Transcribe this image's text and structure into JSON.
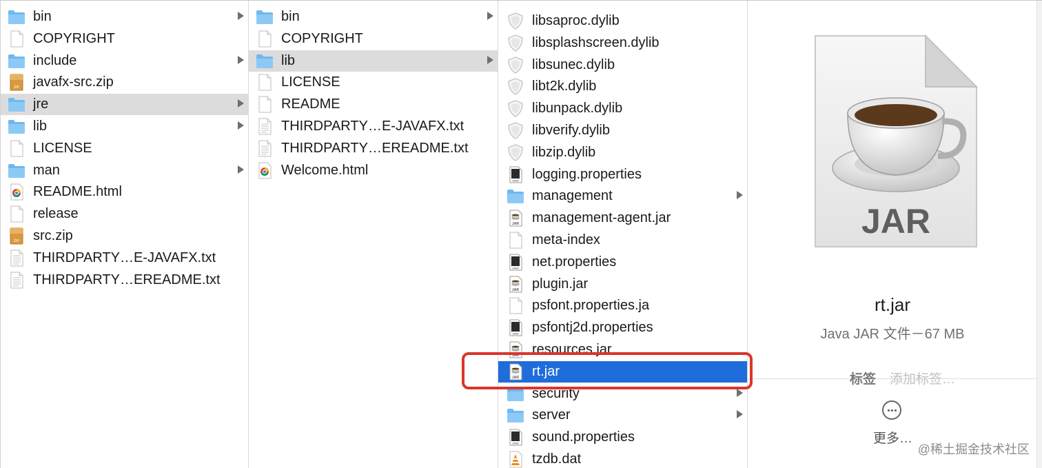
{
  "column1": {
    "items": [
      {
        "label": "bin",
        "icon": "folder-icon",
        "folder": true
      },
      {
        "label": "COPYRIGHT",
        "icon": "document-icon"
      },
      {
        "label": "include",
        "icon": "folder-icon",
        "folder": true
      },
      {
        "label": "javafx-src.zip",
        "icon": "zip-archive-icon"
      },
      {
        "label": "jre",
        "icon": "folder-icon",
        "folder": true,
        "selected": "gray"
      },
      {
        "label": "lib",
        "icon": "folder-icon",
        "folder": true
      },
      {
        "label": "LICENSE",
        "icon": "document-icon"
      },
      {
        "label": "man",
        "icon": "folder-icon",
        "folder": true
      },
      {
        "label": "README.html",
        "icon": "chrome-html-icon"
      },
      {
        "label": "release",
        "icon": "document-icon"
      },
      {
        "label": "src.zip",
        "icon": "zip-archive-icon"
      },
      {
        "label": "THIRDPARTY…E-JAVAFX.txt",
        "icon": "text-file-icon"
      },
      {
        "label": "THIRDPARTY…EREADME.txt",
        "icon": "text-file-icon"
      }
    ]
  },
  "column2": {
    "items": [
      {
        "label": "bin",
        "icon": "folder-icon",
        "folder": true
      },
      {
        "label": "COPYRIGHT",
        "icon": "document-icon"
      },
      {
        "label": "lib",
        "icon": "folder-icon",
        "folder": true,
        "selected": "gray"
      },
      {
        "label": "LICENSE",
        "icon": "document-icon"
      },
      {
        "label": "README",
        "icon": "document-icon"
      },
      {
        "label": "THIRDPARTY…E-JAVAFX.txt",
        "icon": "text-file-icon"
      },
      {
        "label": "THIRDPARTY…EREADME.txt",
        "icon": "text-file-icon"
      },
      {
        "label": "Welcome.html",
        "icon": "chrome-html-icon"
      }
    ]
  },
  "column3": {
    "items": [
      {
        "label": "libsaproc.dylib",
        "icon": "dylib-shield-icon"
      },
      {
        "label": "libsplashscreen.dylib",
        "icon": "dylib-shield-icon"
      },
      {
        "label": "libsunec.dylib",
        "icon": "dylib-shield-icon"
      },
      {
        "label": "libt2k.dylib",
        "icon": "dylib-shield-icon"
      },
      {
        "label": "libunpack.dylib",
        "icon": "dylib-shield-icon"
      },
      {
        "label": "libverify.dylib",
        "icon": "dylib-shield-icon"
      },
      {
        "label": "libzip.dylib",
        "icon": "dylib-shield-icon"
      },
      {
        "label": "logging.properties",
        "icon": "java-properties-icon"
      },
      {
        "label": "management",
        "icon": "folder-icon",
        "folder": true
      },
      {
        "label": "management-agent.jar",
        "icon": "jar-icon"
      },
      {
        "label": "meta-index",
        "icon": "document-icon"
      },
      {
        "label": "net.properties",
        "icon": "java-properties-icon"
      },
      {
        "label": "plugin.jar",
        "icon": "jar-icon"
      },
      {
        "label": "psfont.properties.ja",
        "icon": "document-icon"
      },
      {
        "label": "psfontj2d.properties",
        "icon": "java-properties-icon"
      },
      {
        "label": "resources.jar",
        "icon": "jar-icon"
      },
      {
        "label": "rt.jar",
        "icon": "jar-icon",
        "selected": "blue"
      },
      {
        "label": "security",
        "icon": "folder-icon",
        "folder": true
      },
      {
        "label": "server",
        "icon": "folder-icon",
        "folder": true
      },
      {
        "label": "sound.properties",
        "icon": "java-properties-icon"
      },
      {
        "label": "tzdb.dat",
        "icon": "vlc-cone-icon"
      }
    ]
  },
  "preview": {
    "icon_label": "JAR",
    "file_name": "rt.jar",
    "file_meta": "Java JAR 文件－67 MB",
    "tags_label": "标签",
    "tags_placeholder": "添加标签…",
    "more_label": "更多…"
  },
  "watermark": "@稀土掘金技术社区",
  "colors": {
    "selection_blue": "#1f6ddb",
    "selection_gray": "#dcdcdc",
    "highlight_red": "#d9362a",
    "folder_blue": "#6fb8f0"
  }
}
